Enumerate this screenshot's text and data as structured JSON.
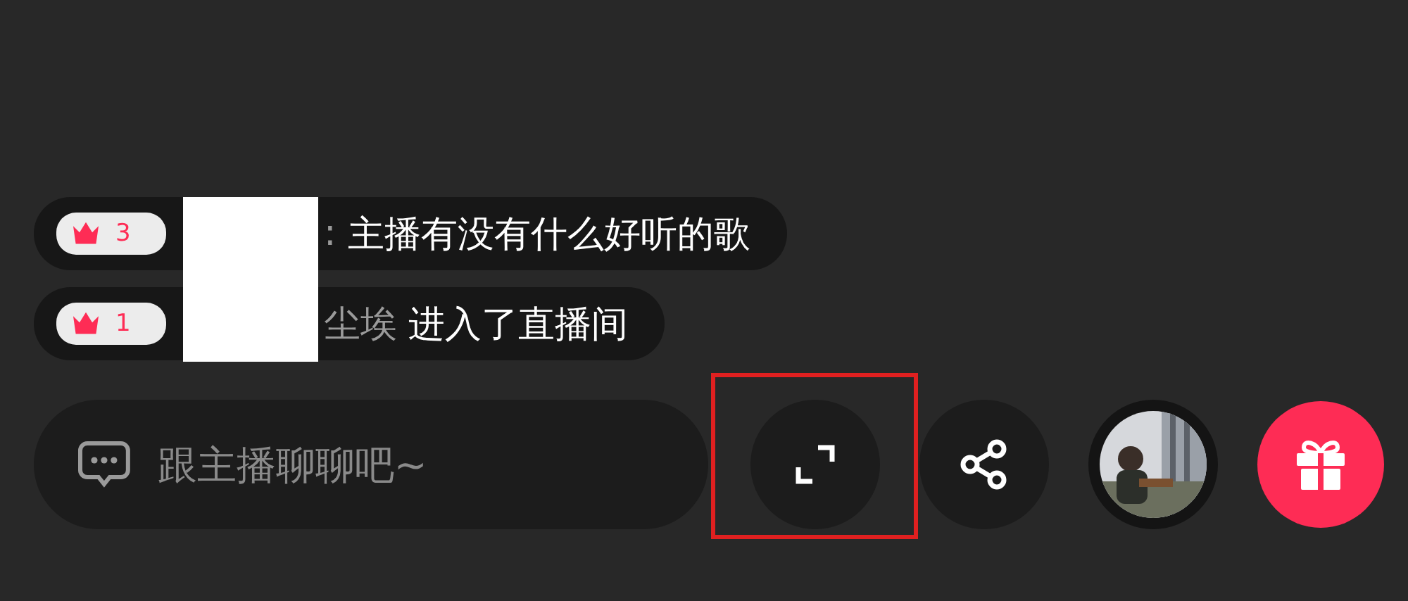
{
  "messages": [
    {
      "level": "3",
      "name": ":",
      "text": "主播有没有什么好听的歌"
    },
    {
      "level": "1",
      "name": "尘埃",
      "text": "进入了直播间"
    }
  ],
  "chat_input": {
    "placeholder": "跟主播聊聊吧~"
  },
  "fullscreen_button": {
    "highlighted": true
  }
}
